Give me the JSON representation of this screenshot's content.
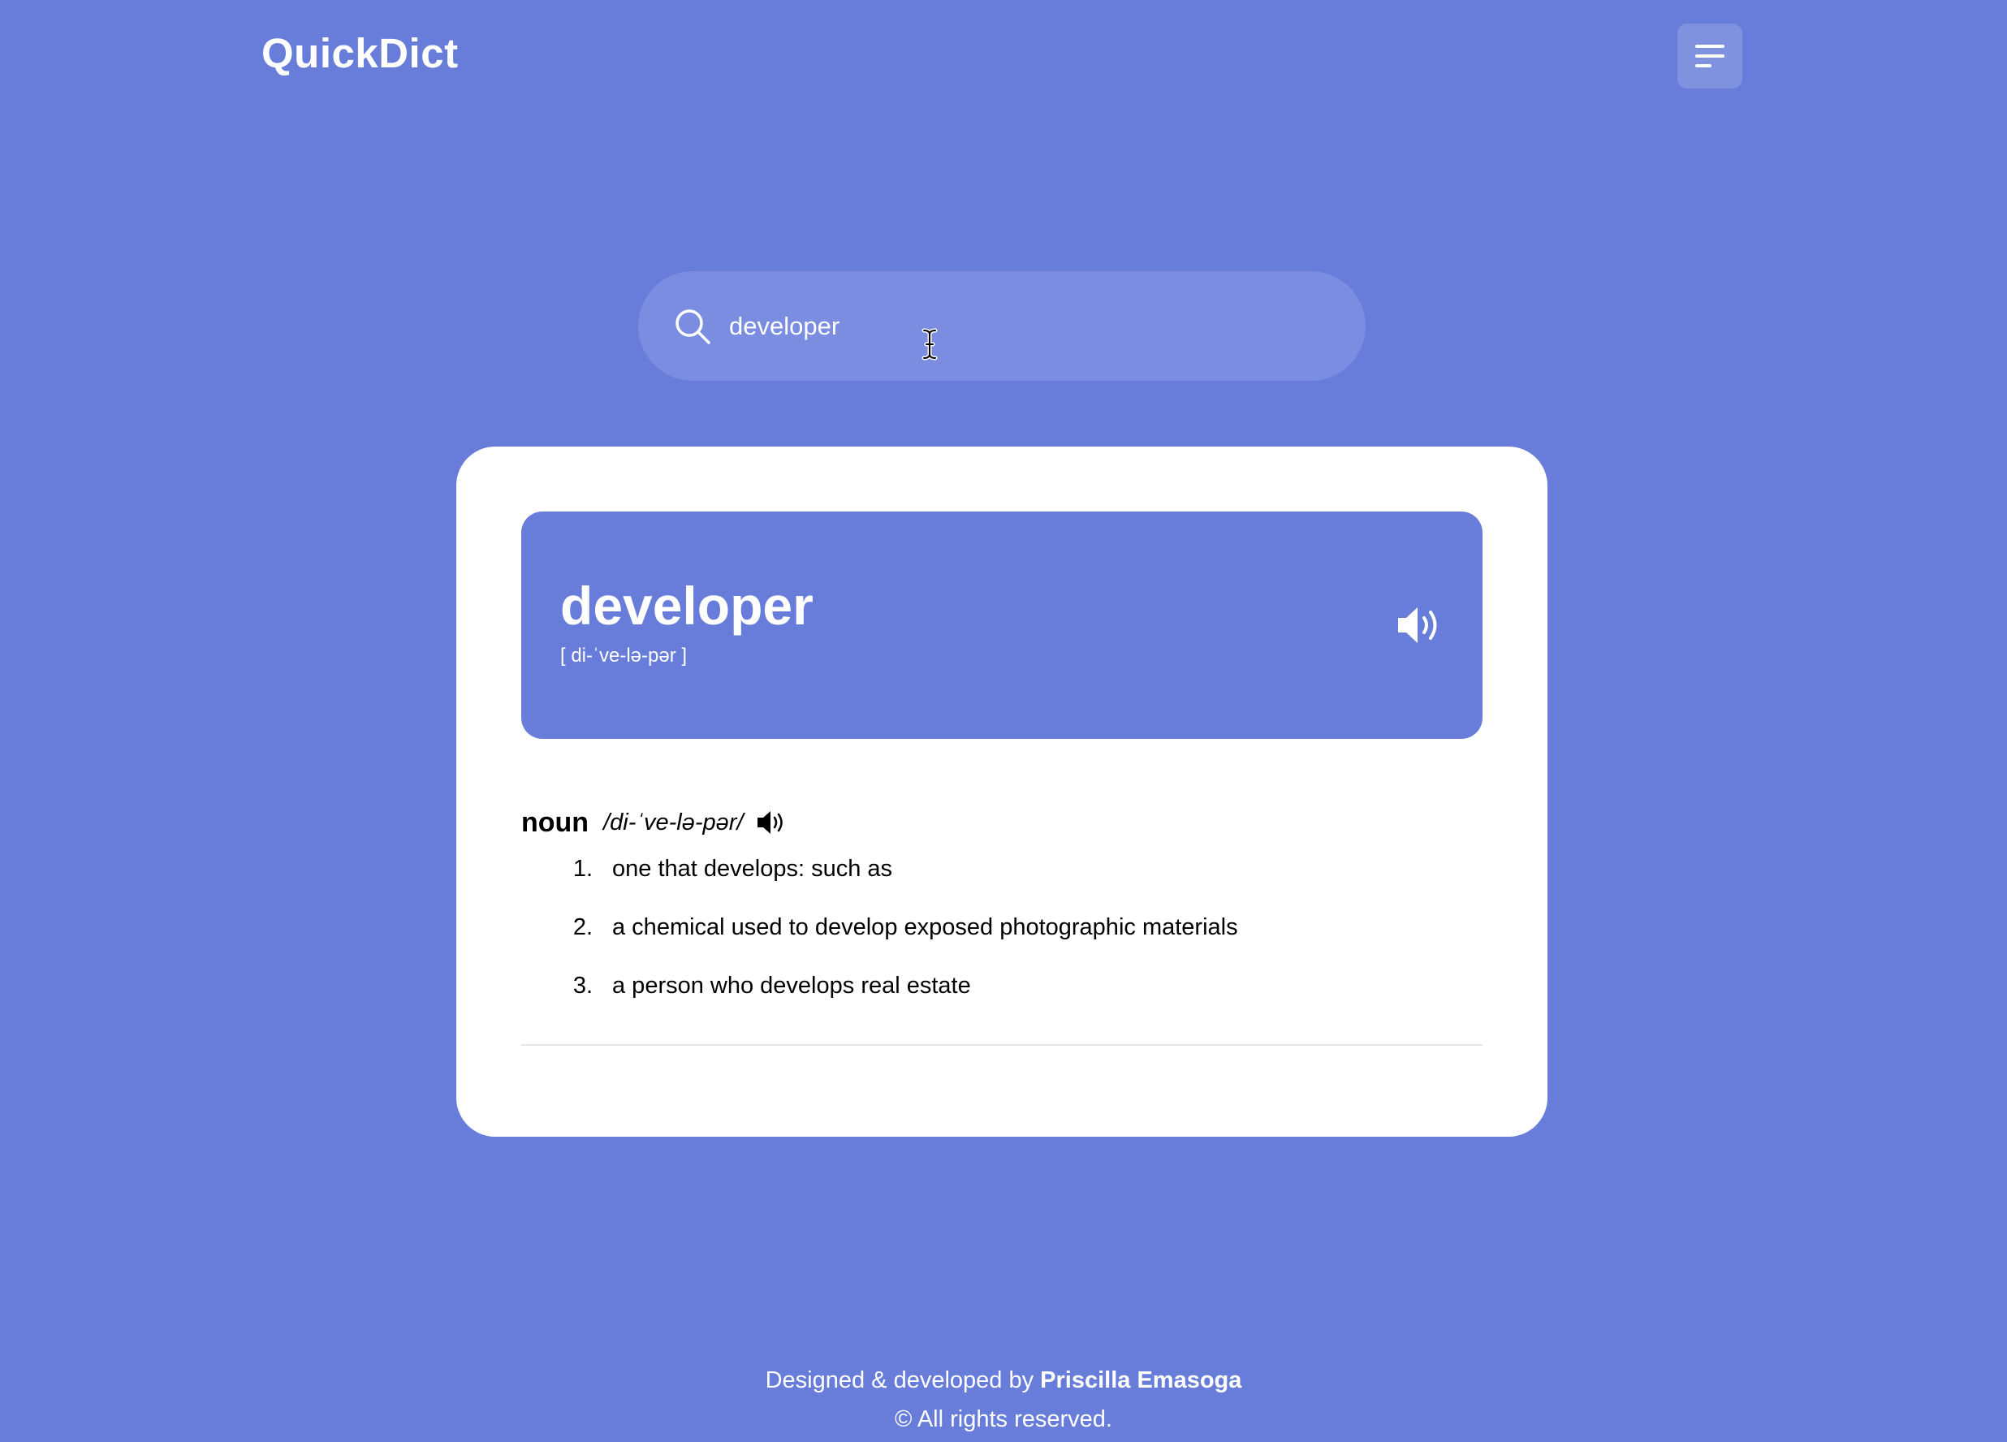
{
  "header": {
    "logo": "QuickDict",
    "menu_icon": "menu-icon"
  },
  "search": {
    "value": "developer",
    "placeholder": "",
    "icon": "search-icon"
  },
  "result": {
    "word": "developer",
    "phonetic": "[ di-ˈve-lə-pər ]",
    "audio_icon": "speaker-icon",
    "meanings": [
      {
        "part_of_speech": "noun",
        "phonetic": "/di-ˈve-lə-pər/",
        "definitions": [
          {
            "num": "1.",
            "text": "one that develops: such as"
          },
          {
            "num": "2.",
            "text": "a chemical used to develop exposed photographic materials"
          },
          {
            "num": "3.",
            "text": "a person who develops real estate"
          }
        ]
      }
    ]
  },
  "footer": {
    "credit_prefix": "Designed & developed by",
    "author": "Priscilla Emasoga",
    "copyright": "© All rights reserved."
  },
  "colors": {
    "background": "#677dd9",
    "search_bg": "#7a8de0",
    "card": "#ffffff"
  }
}
